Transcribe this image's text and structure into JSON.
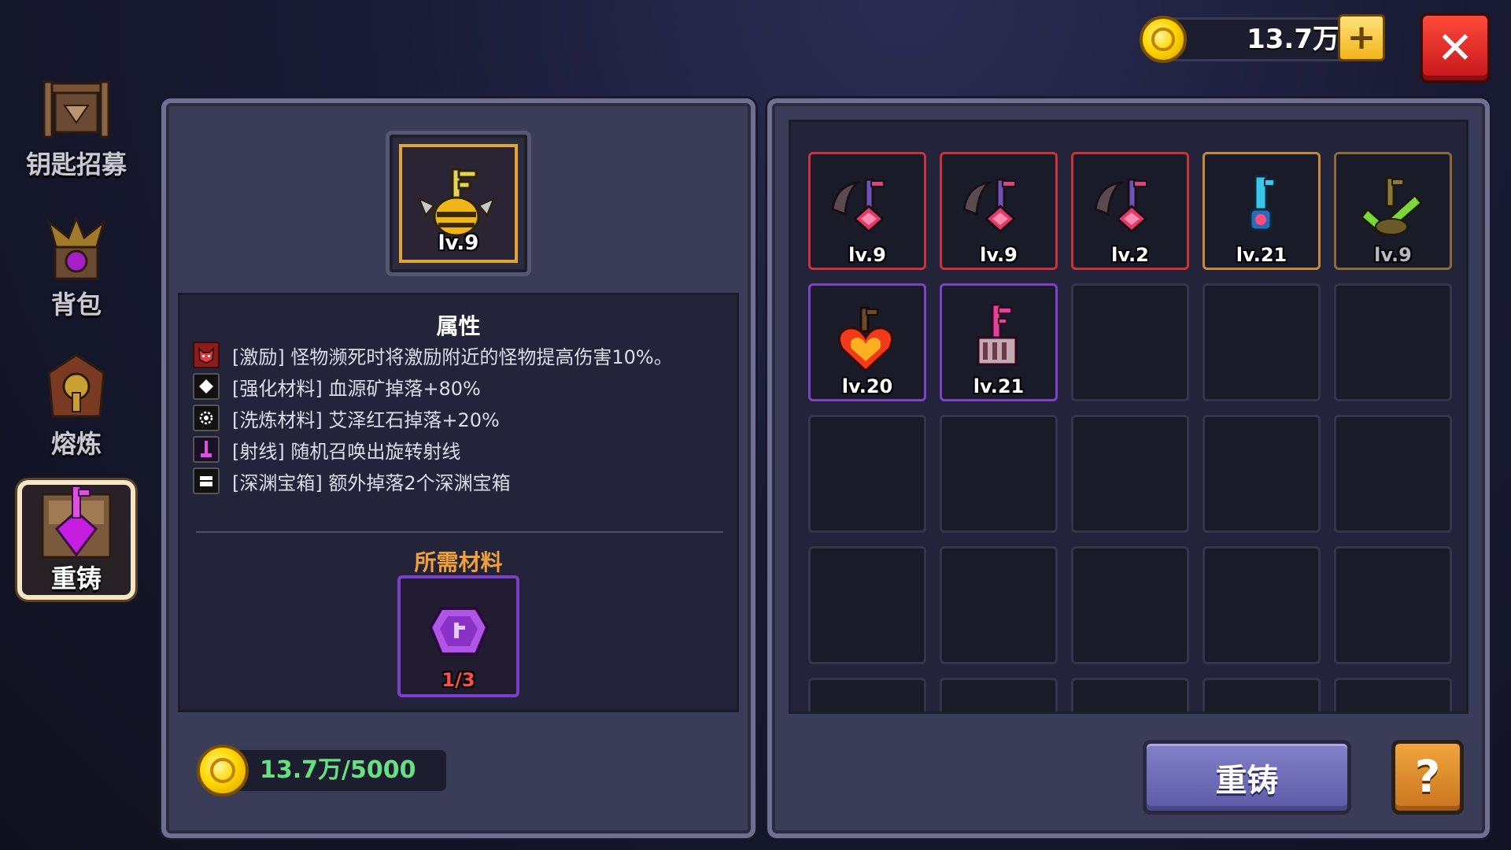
{
  "currency": {
    "amount": "13.7万",
    "icon": "gold-coin-icon"
  },
  "sidebar": {
    "items": [
      {
        "label": "钥匙招募",
        "icon": "recruit-banner-icon",
        "active": false
      },
      {
        "label": "背包",
        "icon": "backpack-chest-icon",
        "active": false
      },
      {
        "label": "熔炼",
        "icon": "smelt-furnace-icon",
        "active": false
      },
      {
        "label": "重铸",
        "icon": "reforge-key-icon",
        "active": true
      }
    ]
  },
  "equipped": {
    "level": "lv.9",
    "icon": "golden-key-icon"
  },
  "attributes": {
    "title": "属性",
    "rows": [
      {
        "icon": "demon-face-icon",
        "text": "[激励] 怪物濒死时将激励附近的怪物提高伤害10%。"
      },
      {
        "icon": "ore-diamond-icon",
        "text": "[强化材料] 血源矿掉落+80%"
      },
      {
        "icon": "gear-stone-icon",
        "text": "[洗炼材料] 艾泽红石掉落+20%"
      },
      {
        "icon": "beam-icon",
        "text": "[射线] 随机召唤出旋转射线"
      },
      {
        "icon": "chest-icon",
        "text": "[深渊宝箱] 额外掉落2个深渊宝箱"
      }
    ]
  },
  "materials": {
    "title": "所需材料",
    "count": "1/3",
    "icon": "purple-gem-icon"
  },
  "cost": {
    "text": "13.7万/5000"
  },
  "inventory": {
    "items": [
      {
        "level": "lv.9",
        "rarity": "red",
        "icon": "scythe-key-icon"
      },
      {
        "level": "lv.9",
        "rarity": "red",
        "icon": "scythe-key-icon"
      },
      {
        "level": "lv.2",
        "rarity": "red",
        "icon": "scythe-key-icon"
      },
      {
        "level": "lv.21",
        "rarity": "gold",
        "icon": "crystal-key-icon"
      },
      {
        "level": "lv.9",
        "rarity": "bronze",
        "icon": "checkmark-key-icon"
      },
      {
        "level": "lv.20",
        "rarity": "purple",
        "icon": "fire-heart-key-icon"
      },
      {
        "level": "lv.21",
        "rarity": "purple",
        "icon": "pink-key-icon"
      }
    ]
  },
  "buttons": {
    "reforge": "重铸",
    "help": "?",
    "close": "✕",
    "plus": "+"
  }
}
